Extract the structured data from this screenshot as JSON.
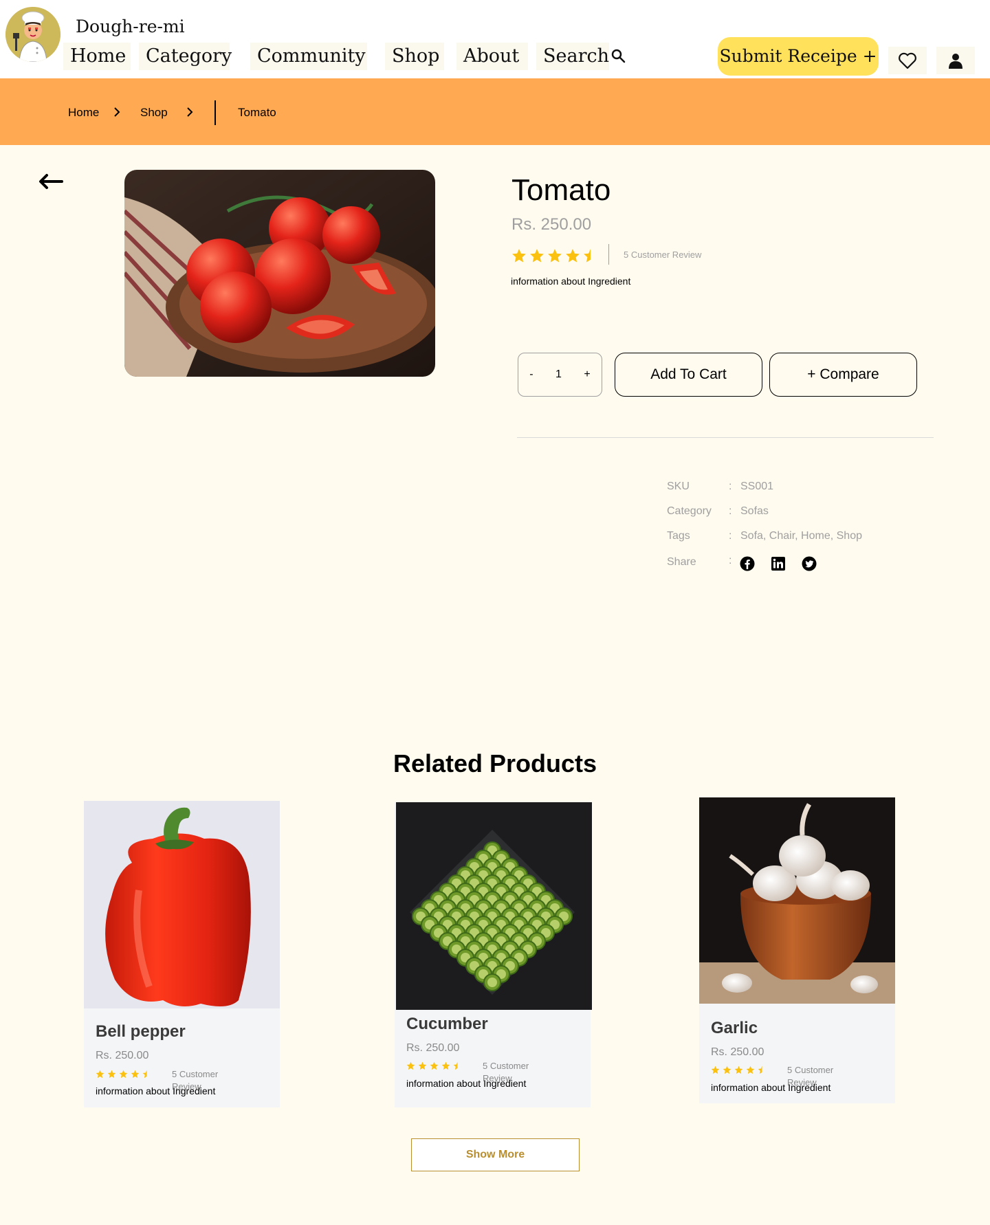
{
  "header": {
    "brand": "Dough-re-mi",
    "nav": [
      "Home",
      "Category",
      "Community",
      "Shop",
      "About",
      "Search"
    ],
    "submit_label": "Submit Receipe +"
  },
  "breadcrumb": {
    "items": [
      "Home",
      "Shop"
    ],
    "current": "Tomato"
  },
  "product": {
    "title": "Tomato",
    "price": "Rs. 250.00",
    "rating": 4.5,
    "review_text": "5 Customer Review",
    "info": "information about Ingredient",
    "quantity": "1",
    "minus": "-",
    "plus": "+",
    "add_to_cart": "Add To Cart",
    "compare": "+  Compare"
  },
  "meta": {
    "sku_label": "SKU",
    "sku_value": "SS001",
    "category_label": "Category",
    "category_value": "Sofas",
    "tags_label": "Tags",
    "tags_value": "Sofa, Chair, Home, Shop",
    "share_label": "Share",
    "colon": ":",
    "share_icons": [
      "facebook-icon",
      "linkedin-icon",
      "twitter-icon"
    ]
  },
  "related": {
    "title": "Related Products",
    "items": [
      {
        "name": "Bell pepper",
        "price": "Rs. 250.00",
        "rating": 4.5,
        "review": "5 Customer Review",
        "info": "information about Ingredient"
      },
      {
        "name": "Cucumber",
        "price": "Rs. 250.00",
        "rating": 4.5,
        "review": "5 Customer Review",
        "info": "information about Ingredient"
      },
      {
        "name": "Garlic",
        "price": "Rs. 250.00",
        "rating": 4.5,
        "review": "5 Customer Review",
        "info": "information about Ingredient"
      }
    ],
    "show_more": "Show More"
  },
  "colors": {
    "crumb_bar": "#ffaa52",
    "submit_button": "#ffe15c",
    "star": "#fbc110",
    "page_bg": "#fffbef",
    "accent_gold": "#b88e2f"
  }
}
